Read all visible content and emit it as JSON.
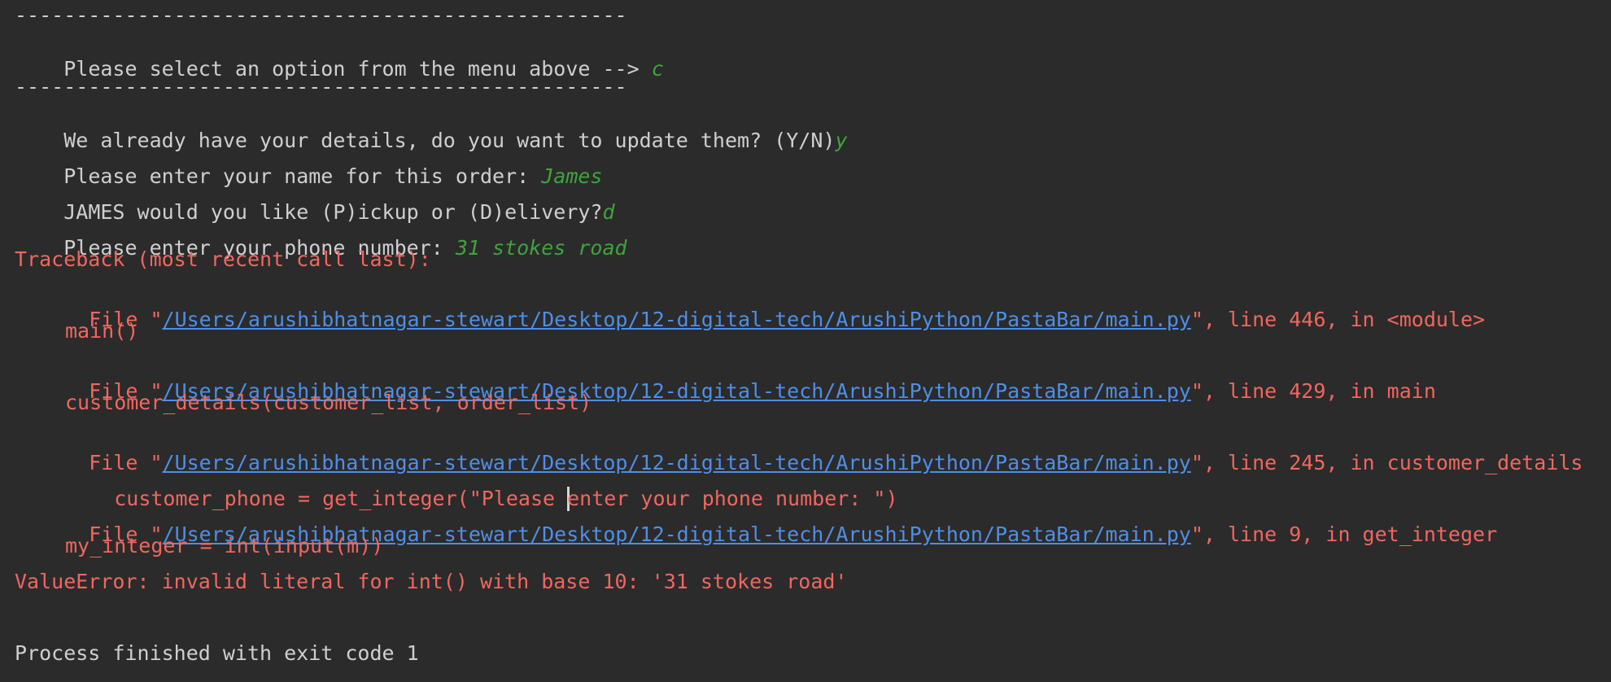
{
  "console": {
    "separator_1": "--------------------------------------------------",
    "menu_prompt": "Please select an option from the menu above --> ",
    "menu_input": "c",
    "separator_2": "--------------------------------------------------",
    "update_prompt": "We already have your details, do you want to update them? (Y/N)",
    "update_input": "y",
    "name_prompt": "Please enter your name for this order: ",
    "name_input": "James",
    "delivery_prompt": "JAMES would you like (P)ickup or (D)elivery?",
    "delivery_input": "d",
    "phone_prompt": "Please enter your phone number: ",
    "phone_input": "31 stokes road",
    "traceback_header": "Traceback (most recent call last):",
    "frames": [
      {
        "prefix": "File \"",
        "path": "/Users/arushibhatnagar-stewart/Desktop/12-digital-tech/ArushiPython/PastaBar/main.py",
        "suffix": "\", line 446, in <module>",
        "code": "main()"
      },
      {
        "prefix": "File \"",
        "path": "/Users/arushibhatnagar-stewart/Desktop/12-digital-tech/ArushiPython/PastaBar/main.py",
        "suffix": "\", line 429, in main",
        "code": "customer_details(customer_list, order_list)"
      },
      {
        "prefix": "File \"",
        "path": "/Users/arushibhatnagar-stewart/Desktop/12-digital-tech/ArushiPython/PastaBar/main.py",
        "suffix": "\", line 245, in customer_details",
        "code_before_caret": "customer_phone = get_integer(\"Please ",
        "code_after_caret": "enter your phone number: \")"
      },
      {
        "prefix": "File \"",
        "path": "/Users/arushibhatnagar-stewart/Desktop/12-digital-tech/ArushiPython/PastaBar/main.py",
        "suffix": "\", line 9, in get_integer",
        "code": "my_integer = int(input(m))"
      }
    ],
    "error_message": "ValueError: invalid literal for int() with base 10: '31 stokes road'",
    "exit_message": "Process finished with exit code 1"
  },
  "colors": {
    "background": "#2b2b2b",
    "output_text": "#cfcfcf",
    "user_input": "#3fa33f",
    "error_text": "#f0675f",
    "link": "#4e8fe6"
  }
}
